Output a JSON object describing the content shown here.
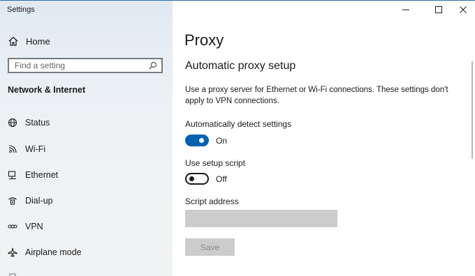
{
  "window": {
    "title": "Settings"
  },
  "sidebar": {
    "home_label": "Home",
    "search_placeholder": "Find a setting",
    "section_title": "Network & Internet",
    "items": [
      {
        "label": "Status",
        "icon": "globe-icon"
      },
      {
        "label": "Wi-Fi",
        "icon": "wifi-icon"
      },
      {
        "label": "Ethernet",
        "icon": "ethernet-icon"
      },
      {
        "label": "Dial-up",
        "icon": "dialup-icon"
      },
      {
        "label": "VPN",
        "icon": "vpn-icon"
      },
      {
        "label": "Airplane mode",
        "icon": "airplane-icon"
      }
    ]
  },
  "main": {
    "page_title": "Proxy",
    "section_title": "Automatic proxy setup",
    "description": "Use a proxy server for Ethernet or Wi-Fi connections. These settings don't apply to VPN connections.",
    "auto_detect": {
      "label": "Automatically detect settings",
      "state": "On"
    },
    "setup_script": {
      "label": "Use setup script",
      "state": "Off"
    },
    "script_address": {
      "label": "Script address",
      "value": ""
    },
    "save_label": "Save"
  },
  "colors": {
    "accent": "#0063b1",
    "disabled_bg": "#cccccc",
    "disabled_text": "#8a8a8a"
  }
}
